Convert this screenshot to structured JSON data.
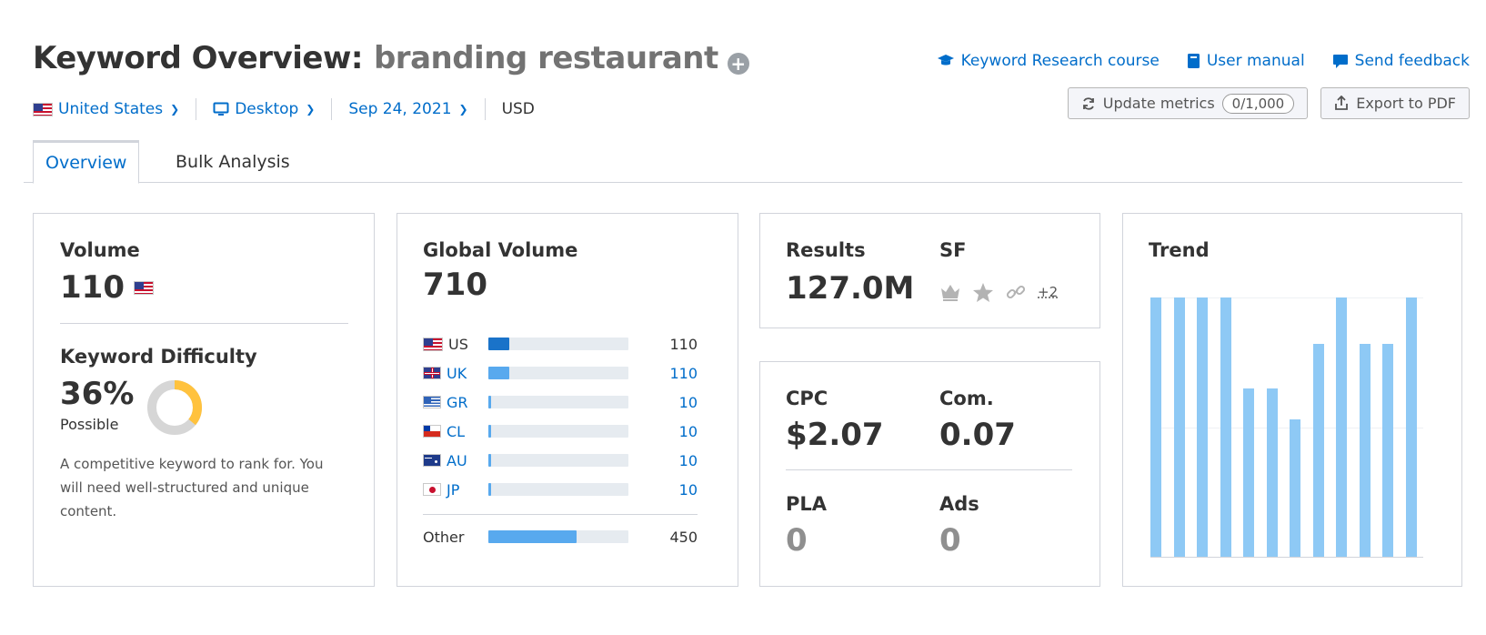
{
  "header": {
    "title_prefix": "Keyword Overview:",
    "keyword": "branding restaurant",
    "add_icon": "plus-circle-icon"
  },
  "top_links": [
    {
      "label": "Keyword Research course",
      "icon": "graduation-cap-icon"
    },
    {
      "label": "User manual",
      "icon": "book-icon"
    },
    {
      "label": "Send feedback",
      "icon": "chat-bubble-icon"
    }
  ],
  "filters": {
    "country": "United States",
    "device": "Desktop",
    "date": "Sep 24, 2021",
    "currency": "USD"
  },
  "actions": {
    "update_label": "Update metrics",
    "update_count": "0/1,000",
    "export_label": "Export to PDF"
  },
  "tabs": [
    {
      "label": "Overview",
      "active": true
    },
    {
      "label": "Bulk Analysis",
      "active": false
    }
  ],
  "volume_card": {
    "label": "Volume",
    "value": "110",
    "kd_label": "Keyword Difficulty",
    "kd_value": "36%",
    "kd_status": "Possible",
    "kd_fraction": 0.36,
    "kd_color": "#ffc23e",
    "description": "A competitive keyword to rank for. You will need well-structured and unique content."
  },
  "global_volume_card": {
    "label": "Global Volume",
    "value": "710",
    "rows": [
      {
        "code": "US",
        "flag": "flag-us",
        "value": "110",
        "share": 0.15
      },
      {
        "code": "UK",
        "flag": "flag-uk",
        "value": "110",
        "share": 0.15
      },
      {
        "code": "GR",
        "flag": "flag-gr",
        "value": "10",
        "share": 0.02
      },
      {
        "code": "CL",
        "flag": "flag-cl",
        "value": "10",
        "share": 0.02
      },
      {
        "code": "AU",
        "flag": "flag-au",
        "value": "10",
        "share": 0.02
      },
      {
        "code": "JP",
        "flag": "flag-jp",
        "value": "10",
        "share": 0.02
      }
    ],
    "other": {
      "label": "Other",
      "value": "450",
      "share": 0.63
    }
  },
  "results_card": {
    "results_label": "Results",
    "results_value": "127.0M",
    "sf_label": "SF",
    "sf_icons": [
      "crown-icon",
      "star-icon",
      "link-icon"
    ],
    "sf_more": "+2"
  },
  "cpc_card": {
    "cpc_label": "CPC",
    "cpc_value": "$2.07",
    "com_label": "Com.",
    "com_value": "0.07",
    "pla_label": "PLA",
    "pla_value": "0",
    "ads_label": "Ads",
    "ads_value": "0"
  },
  "trend_card": {
    "label": "Trend",
    "bar_color": "#8ec9f5"
  },
  "chart_data": {
    "type": "bar",
    "title": "Trend",
    "values": [
      1.0,
      1.0,
      1.0,
      1.0,
      0.65,
      0.65,
      0.53,
      0.82,
      1.0,
      0.82,
      0.82,
      1.0
    ],
    "ylim": [
      0,
      1
    ],
    "grid": true
  }
}
